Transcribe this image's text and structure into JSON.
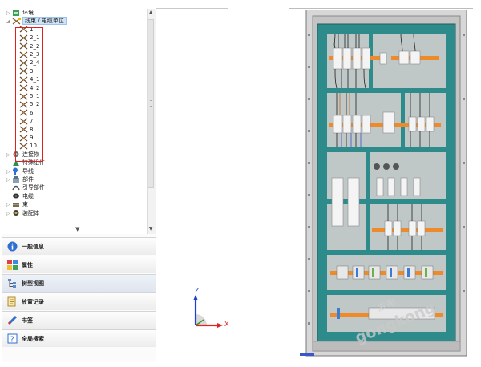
{
  "tree": {
    "items": [
      {
        "label": "环境",
        "icon": "environment-icon",
        "expander": "▷"
      },
      {
        "label": "线束 / 电缆单位",
        "icon": "harness-icon",
        "expander": "◢",
        "selected": true
      },
      {
        "label": "1",
        "icon": "wire-icon"
      },
      {
        "label": "2_1",
        "icon": "wire-icon"
      },
      {
        "label": "2_2",
        "icon": "wire-icon"
      },
      {
        "label": "2_3",
        "icon": "wire-icon"
      },
      {
        "label": "2_4",
        "icon": "wire-icon"
      },
      {
        "label": "3",
        "icon": "wire-icon"
      },
      {
        "label": "4_1",
        "icon": "wire-icon"
      },
      {
        "label": "4_2",
        "icon": "wire-icon"
      },
      {
        "label": "5_1",
        "icon": "wire-icon"
      },
      {
        "label": "5_2",
        "icon": "wire-icon"
      },
      {
        "label": "6",
        "icon": "wire-icon"
      },
      {
        "label": "7",
        "icon": "wire-icon"
      },
      {
        "label": "8",
        "icon": "wire-icon"
      },
      {
        "label": "9",
        "icon": "wire-icon"
      },
      {
        "label": "10",
        "icon": "wire-icon"
      },
      {
        "label": "连接物",
        "icon": "connector-icon",
        "expander": "▷"
      },
      {
        "label": "特殊组件",
        "icon": "special-component-icon"
      },
      {
        "label": "导线",
        "icon": "conductor-icon",
        "expander": "▷"
      },
      {
        "label": "部件",
        "icon": "part-icon",
        "expander": "▷"
      },
      {
        "label": "引导部件",
        "icon": "guide-part-icon"
      },
      {
        "label": "电缆",
        "icon": "cable-icon"
      },
      {
        "label": "束",
        "icon": "bundle-icon",
        "expander": "▷"
      },
      {
        "label": "装配体",
        "icon": "assembly-icon",
        "expander": "▷"
      }
    ]
  },
  "accordion": {
    "items": [
      {
        "label": "一般信息",
        "icon": "info-icon"
      },
      {
        "label": "属性",
        "icon": "properties-icon"
      },
      {
        "label": "树型视图",
        "icon": "tree-view-icon",
        "active": true
      },
      {
        "label": "放置记录",
        "icon": "placement-log-icon"
      },
      {
        "label": "书签",
        "icon": "bookmark-icon"
      },
      {
        "label": "全局搜索",
        "icon": "help-search-icon"
      }
    ]
  },
  "axes": {
    "z_label": "Z",
    "x_label": "X"
  },
  "watermark": {
    "text": "gongkong",
    "text2": "发布"
  },
  "colors": {
    "teal": "#2e8b8b",
    "orange": "#ef8a2a",
    "selection_box": "#e02020"
  }
}
